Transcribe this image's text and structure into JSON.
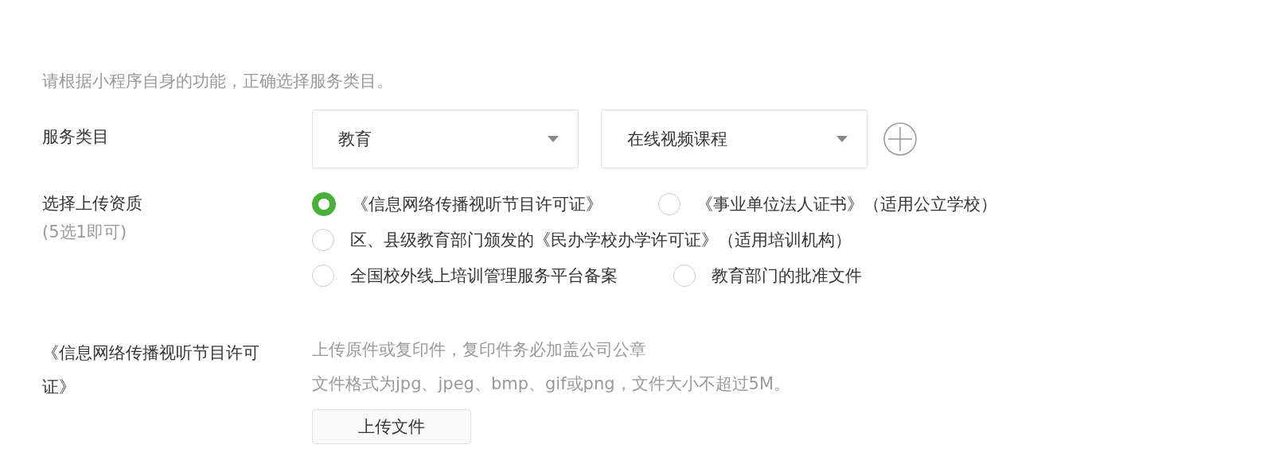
{
  "hint": "请根据小程序自身的功能，正确选择服务类目。",
  "service_category": {
    "label": "服务类目",
    "selects": [
      {
        "value": "教育"
      },
      {
        "value": "在线视频课程"
      }
    ]
  },
  "qualification": {
    "label": "选择上传资质",
    "sublabel": "(5选1即可)",
    "rows": [
      [
        {
          "label": "《信息网络传播视听节目许可证》",
          "selected": true
        },
        {
          "label": "《事业单位法人证书》（适用公立学校）",
          "selected": false
        }
      ],
      [
        {
          "label": "区、县级教育部门颁发的《民办学校办学许可证》（适用培训机构）",
          "selected": false
        }
      ],
      [
        {
          "label": "全国校外线上培训管理服务平台备案",
          "selected": false
        },
        {
          "label": "教育部门的批准文件",
          "selected": false
        }
      ]
    ]
  },
  "upload": {
    "label": "《信息网络传播视听节目许可证》",
    "notes": [
      "上传原件或复印件，复印件务必加盖公司公章",
      "文件格式为jpg、jpeg、bmp、gif或png，文件大小不超过5M。"
    ],
    "button": "上传文件"
  }
}
